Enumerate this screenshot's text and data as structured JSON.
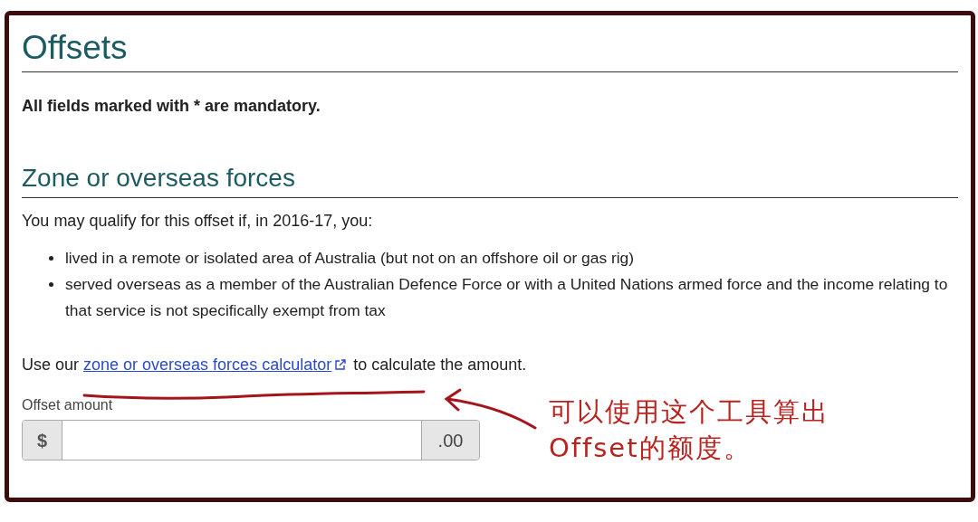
{
  "heading": "Offsets",
  "mandatory_note": "All fields marked with * are mandatory.",
  "section": {
    "heading": "Zone or overseas forces",
    "intro": "You may qualify for this offset if, in 2016-17, you:",
    "bullets": [
      "lived in a remote or isolated area of Australia (but not on an offshore oil or gas rig)",
      "served overseas as a member of the Australian Defence Force or with a United Nations armed force and the income relating to that service is not specifically exempt from tax"
    ],
    "calc_before": "Use our",
    "calc_link": "zone or overseas forces calculator",
    "calc_after": "to calculate the amount.",
    "field": {
      "label": "Offset amount",
      "prefix": "$",
      "suffix": ".00"
    }
  },
  "annotation": {
    "lines": [
      "可以使用这个工具算出",
      "Offset的额度。"
    ]
  }
}
